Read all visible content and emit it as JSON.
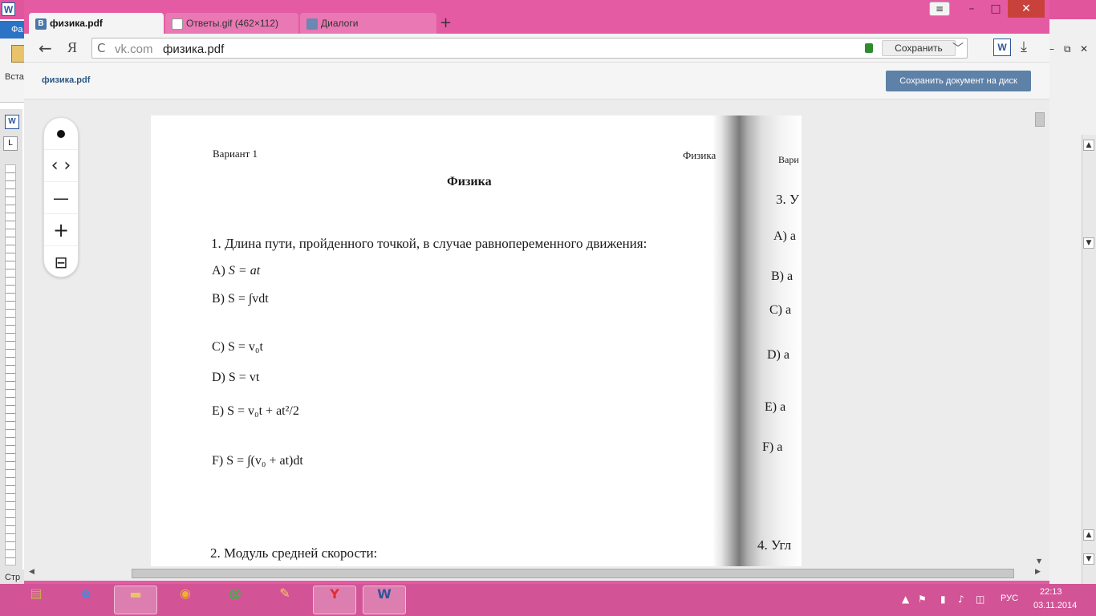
{
  "word": {
    "app_icon": "W",
    "file_tab_label": "Фа",
    "paste_label": "Вста",
    "small_icon": "W",
    "ruler_button": "L",
    "status_text": "Стр",
    "ctrl_min": "–",
    "ctrl_restore": "⧉",
    "ctrl_close": "✕"
  },
  "browser": {
    "tabs": [
      {
        "label": "физика.pdf",
        "icon": "vk-icon",
        "icon_text": "В"
      },
      {
        "label": "Ответы.gif (462×112)",
        "icon": "file-icon"
      },
      {
        "label": "Диалоги",
        "icon": "dialog-icon"
      }
    ],
    "new_tab": "+",
    "window_buttons": {
      "menu": "≡",
      "minimize": "–",
      "maximize": "□",
      "close": "✕"
    },
    "nav": {
      "back": "←",
      "yandex": "Я",
      "reload": "C"
    },
    "omnibox": {
      "host": "vk.com",
      "title": "физика.pdf",
      "save_label": "Сохранить",
      "chevron": "﹀"
    },
    "ext_word_icon": "W",
    "download_icon": "⤓"
  },
  "docview": {
    "filename": "физика.pdf",
    "save_to_disk": "Сохранить документ на диск",
    "zoom_controls": {
      "prev_next": "‹ ›",
      "zoom_out": "—",
      "zoom_in": "+",
      "fit": "⊟"
    }
  },
  "page": {
    "header_variant": "Вариант 1",
    "header_subject": "Физика",
    "title": "Физика",
    "question1": "1. Длина пути, пройденного точкой, в случае равнопеременного движения:",
    "options": [
      {
        "label": "A)",
        "expr": "S = at"
      },
      {
        "label": "B)",
        "expr": "S = ∫vdt"
      },
      {
        "label": "C)",
        "expr": "S = v₀t"
      },
      {
        "label": "D)",
        "expr": "S = vt"
      },
      {
        "label": "E)",
        "expr": "S = v₀t + at²/2"
      },
      {
        "label": "F)",
        "expr": "S = ∫(v₀ + at)dt"
      }
    ],
    "question2": "2. Модуль средней скорости:",
    "right_fragments": [
      "Вари",
      "3. У",
      "A) a",
      "B) a",
      "C) a",
      "D) a",
      "E) a",
      "F) a",
      "4. Угл"
    ]
  },
  "taskbar": {
    "language": "РУС",
    "time": "22:13",
    "date": "03.11.2014"
  },
  "colors": {
    "titlebar_pink": "#e45ba3",
    "taskbar_pink": "#d25396",
    "vk_blue": "#4a76a8",
    "save_button_blue": "#5e81a8"
  }
}
